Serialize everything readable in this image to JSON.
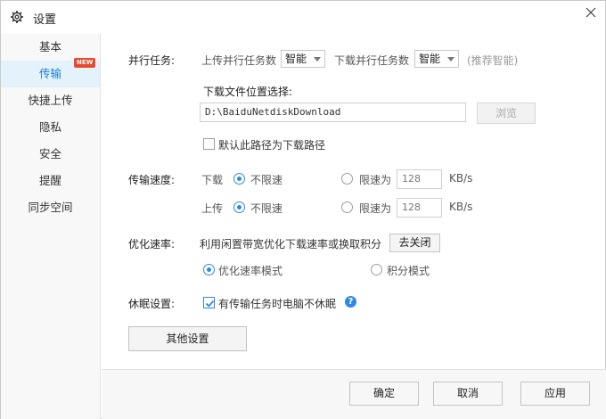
{
  "window": {
    "title": "设置"
  },
  "sidebar": {
    "items": [
      {
        "label": "基本",
        "active": false
      },
      {
        "label": "传输",
        "active": true
      },
      {
        "label": "快捷上传",
        "active": false
      },
      {
        "label": "隐私",
        "active": false
      },
      {
        "label": "安全",
        "active": false
      },
      {
        "label": "提醒",
        "active": false
      },
      {
        "label": "同步空间",
        "active": false
      }
    ],
    "new_badge": "NEW"
  },
  "parallel": {
    "label": "并行任务:",
    "upload_label": "上传并行任务数",
    "upload_value": "智能",
    "download_label": "下载并行任务数",
    "download_value": "智能",
    "hint": "(推荐智能)"
  },
  "download_location": {
    "label": "下载文件位置选择:",
    "path": "D:\\BaiduNetdiskDownload",
    "browse": "浏览",
    "default_checkbox": "默认此路径为下载路径",
    "default_checked": false
  },
  "speed": {
    "label": "传输速度:",
    "download_label": "下载",
    "upload_label": "上传",
    "unlimited": "不限速",
    "limit_to": "限速为",
    "download_limit_value": "128",
    "upload_limit_value": "128",
    "unit": "KB/s",
    "download_mode": "unlimited",
    "upload_mode": "unlimited"
  },
  "optimize": {
    "label": "优化速率:",
    "description": "利用闲置带宽优化下载速率或换取积分",
    "close_button": "去关闭",
    "option1": "优化速率模式",
    "option2": "积分模式",
    "selected": "option1"
  },
  "sleep": {
    "label": "休眠设置:",
    "checkbox": "有传输任务时电脑不休眠",
    "checked": true,
    "info_icon": "?"
  },
  "other_button": "其他设置",
  "footer": {
    "ok": "确定",
    "cancel": "取消",
    "apply": "应用"
  },
  "colors": {
    "accent": "#2d8ae0",
    "active_bg": "#e4f2fc",
    "active_text": "#1b7fd6",
    "badge": "#e84a2f"
  },
  "icons": {
    "title": "gear-icon",
    "close": "close-icon",
    "info": "question-circle-icon"
  }
}
